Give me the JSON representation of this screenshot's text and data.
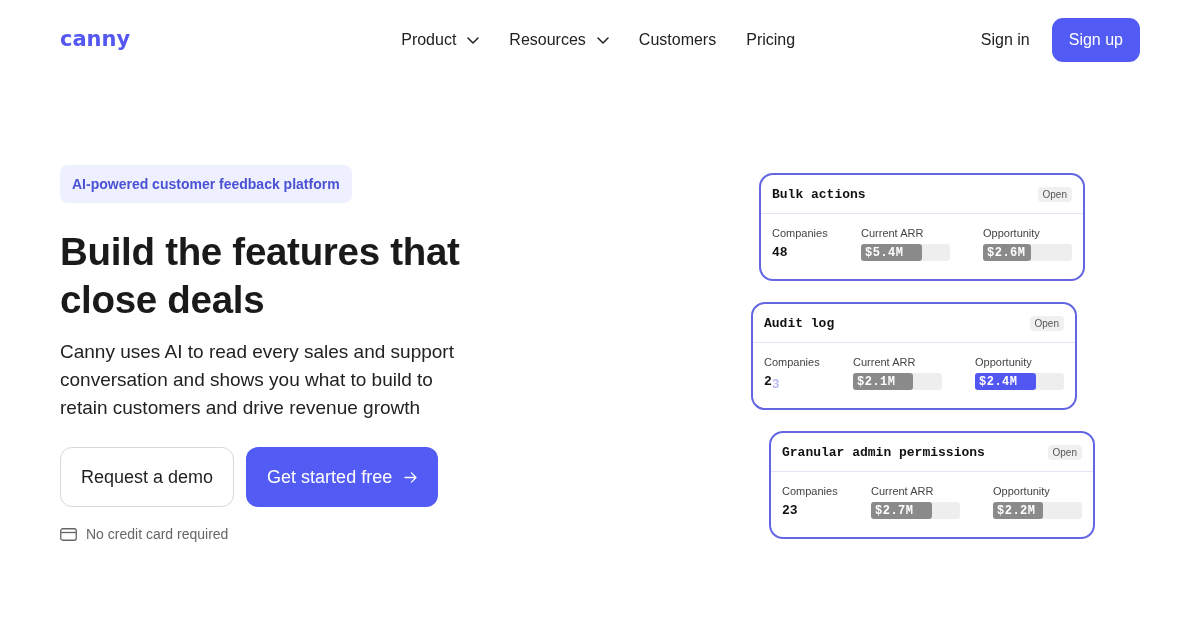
{
  "nav": {
    "logo": "canny",
    "links": [
      {
        "label": "Product",
        "has_menu": true
      },
      {
        "label": "Resources",
        "has_menu": true
      },
      {
        "label": "Customers",
        "has_menu": false
      },
      {
        "label": "Pricing",
        "has_menu": false
      }
    ],
    "sign_in": "Sign in",
    "sign_up": "Sign up"
  },
  "hero": {
    "badge": "AI-powered customer feedback platform",
    "heading": "Build the features that close deals",
    "description": "Canny uses AI to read every sales and support conversation and shows you what to build to retain customers and drive revenue growth",
    "buttons": [
      {
        "label": "Request a demo",
        "kind": "secondary"
      },
      {
        "label": "Get started free",
        "kind": "primary"
      }
    ],
    "note": "No credit card required"
  },
  "cards": [
    {
      "title": "Bulk actions",
      "status": "Open",
      "companies_label": "Companies",
      "companies": "48",
      "metrics": [
        {
          "label": "Current ARR",
          "value": "$5.4M",
          "level": 0.68,
          "highlighted": false
        },
        {
          "label": "Opportunity",
          "value": "$2.6M",
          "level": 0.54,
          "highlighted": false
        }
      ]
    },
    {
      "title": "Audit log",
      "status": "Open",
      "companies_label": "Companies",
      "companies": "2",
      "rolling_digit": "3",
      "metrics": [
        {
          "label": "Current ARR",
          "value": "$2.1M",
          "level": 0.67,
          "highlighted": false
        },
        {
          "label": "Opportunity",
          "value": "$2.4M",
          "level": 0.69,
          "highlighted": true
        }
      ]
    },
    {
      "title": "Granular admin permissions",
      "status": "Open",
      "companies_label": "Companies",
      "companies": "23",
      "metrics": [
        {
          "label": "Current ARR",
          "value": "$2.7M",
          "level": 0.68,
          "highlighted": false
        },
        {
          "label": "Opportunity",
          "value": "$2.2M",
          "level": 0.56,
          "highlighted": false
        }
      ]
    }
  ]
}
